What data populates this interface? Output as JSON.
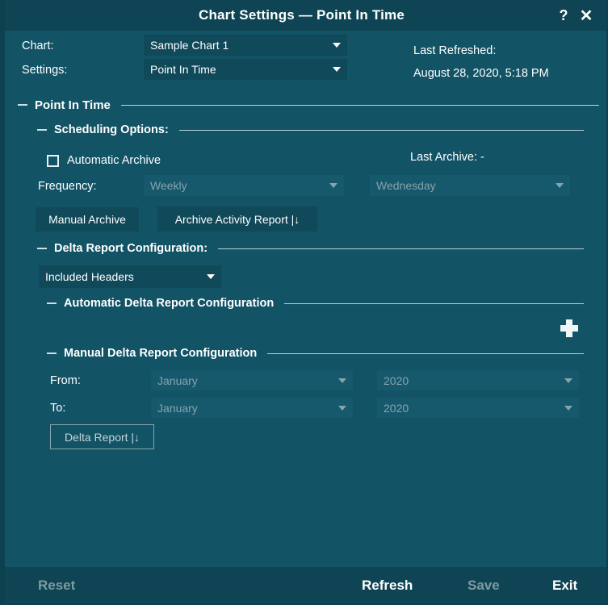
{
  "window": {
    "title": "Chart Settings — Point In Time",
    "help_icon": "question-mark-icon",
    "close_icon": "close-x-icon",
    "help_glyph": "?",
    "close_glyph": "✕"
  },
  "theme": {
    "background": "#125366",
    "titlebar": "#0e4454",
    "field_enabled": "#10495a",
    "field_disabled": "#16596c",
    "text": "#ffffff",
    "text_disabled": "#87a3ab",
    "rule": "#bcd2d8"
  },
  "topform": {
    "chart_label": "Chart:",
    "chart_value": "Sample Chart 1",
    "settings_label": "Settings:",
    "settings_value": "Point In Time",
    "last_refreshed_label": "Last Refreshed:",
    "last_refreshed_value": "August 28, 2020, 5:18 PM"
  },
  "sections": {
    "point_in_time": "Point In Time",
    "scheduling_options": "Scheduling Options:",
    "delta_report_configuration": "Delta Report Configuration:",
    "automatic_delta_report_configuration": "Automatic Delta Report Configuration",
    "manual_delta_report_configuration": "Manual Delta Report Configuration"
  },
  "scheduling": {
    "automatic_archive_label": "Automatic Archive",
    "automatic_archive_checked": false,
    "last_archive": "Last Archive: -",
    "frequency_label": "Frequency:",
    "frequency_value": "Weekly",
    "weekday_value": "Wednesday",
    "manual_archive_button": "Manual Archive",
    "archive_activity_report_button": "Archive Activity Report |↓"
  },
  "delta": {
    "included_headers_value": "Included Headers",
    "add_icon": "plus-icon",
    "from_label": "From:",
    "to_label": "To:",
    "from_month": "January",
    "from_year": "2020",
    "to_month": "January",
    "to_year": "2020",
    "delta_report_button": "Delta Report |↓"
  },
  "footer": {
    "reset": "Reset",
    "refresh": "Refresh",
    "save": "Save",
    "exit": "Exit"
  }
}
